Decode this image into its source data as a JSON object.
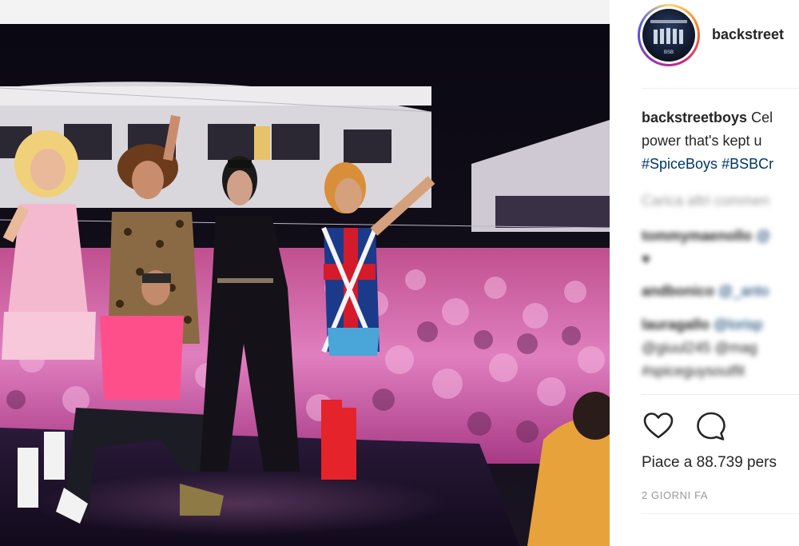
{
  "post": {
    "image_alt": "Backstreet Boys dressed as the Spice Girls on a cruise ship stage at night"
  },
  "profile": {
    "username": "backstreet",
    "avatar_label": "BSB"
  },
  "caption": {
    "username": "backstreetboys",
    "line1": "Cel",
    "line2": "power that's kept u",
    "hashtag1": "#SpiceBoys",
    "hashtag2": "#BSBCr"
  },
  "comments": {
    "load_more": "Carica altri commen",
    "items": [
      {
        "user": "tommymaenollo",
        "text": "@",
        "extra": "♥"
      },
      {
        "user": "andbonico",
        "text": "@_anto"
      },
      {
        "user": "lauragallo",
        "text": "@lorisp",
        "line2": "@giuul245 @mag",
        "line3": "#spiceguysoutfit"
      }
    ]
  },
  "actions": {
    "like_icon": "heart-icon",
    "comment_icon": "comment-icon"
  },
  "likes": {
    "text": "Piace a 88.739 pers"
  },
  "time_ago": "2 GIORNI FA",
  "colors": {
    "hashtag": "#003569",
    "muted": "#999999",
    "text": "#262626"
  }
}
